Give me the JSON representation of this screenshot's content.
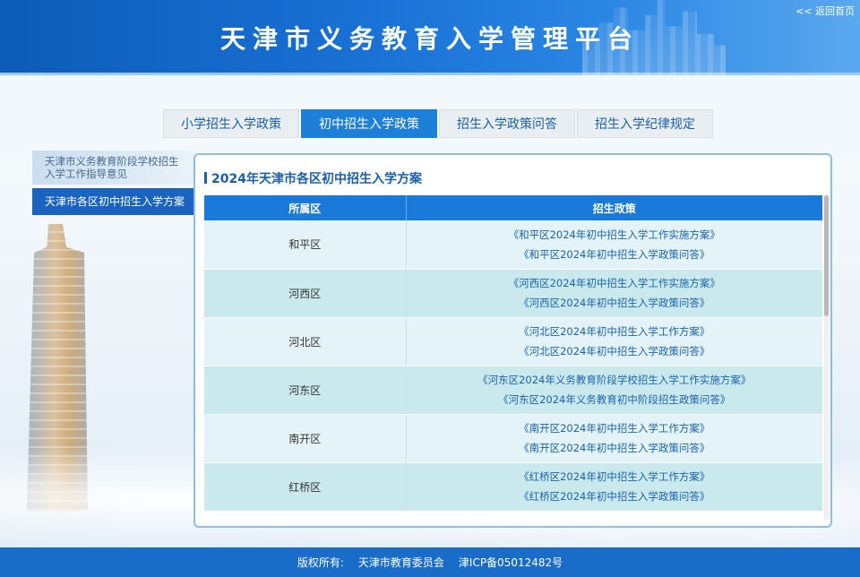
{
  "header": {
    "title": "天津市义务教育入学管理平台",
    "back_link": "<< 返回首页"
  },
  "tabs": [
    {
      "label": "小学招生入学政策",
      "active": false
    },
    {
      "label": "初中招生入学政策",
      "active": true
    },
    {
      "label": "招生入学政策问答",
      "active": false
    },
    {
      "label": "招生入学纪律规定",
      "active": false
    }
  ],
  "sidebar": {
    "items": [
      {
        "label": "天津市义务教育阶段学校招生入学工作指导意见",
        "active": false
      },
      {
        "label": "天津市各区初中招生入学方案",
        "active": true
      }
    ]
  },
  "panel": {
    "title": "2024年天津市各区初中招生入学方案",
    "columns": [
      "所属区",
      "招生政策"
    ],
    "rows": [
      {
        "district": "和平区",
        "links": [
          "《和平区2024年初中招生入学工作实施方案》",
          "《和平区2024年初中招生入学政策问答》"
        ]
      },
      {
        "district": "河西区",
        "links": [
          "《河西区2024年初中招生入学工作实施方案》",
          "《河西区2024年初中招生入学政策问答》"
        ]
      },
      {
        "district": "河北区",
        "links": [
          "《河北区2024年初中招生入学工作方案》",
          "《河北区2024年初中招生入学政策问答》"
        ]
      },
      {
        "district": "河东区",
        "links": [
          "《河东区2024年义务教育阶段学校招生入学工作实施方案》",
          "《河东区2024年义务教育初中阶段招生政策问答》"
        ]
      },
      {
        "district": "南开区",
        "links": [
          "《南开区2024年初中招生入学工作方案》",
          "《南开区2024年初中招生入学政策问答》"
        ]
      },
      {
        "district": "红桥区",
        "links": [
          "《红桥区2024年初中招生入学工作方案》",
          "《红桥区2024年初中招生入学政策问答》"
        ]
      }
    ]
  },
  "footer": {
    "copyright_label": "版权所有:",
    "owner": "天津市教育委员会",
    "icp": "津ICP备05012482号"
  },
  "colors": {
    "header_blue": "#1a73d6",
    "tab_active": "#1d7fd8",
    "table_header": "#1b7ad9",
    "link": "#1a63b0",
    "footer": "#1a6cc9"
  }
}
